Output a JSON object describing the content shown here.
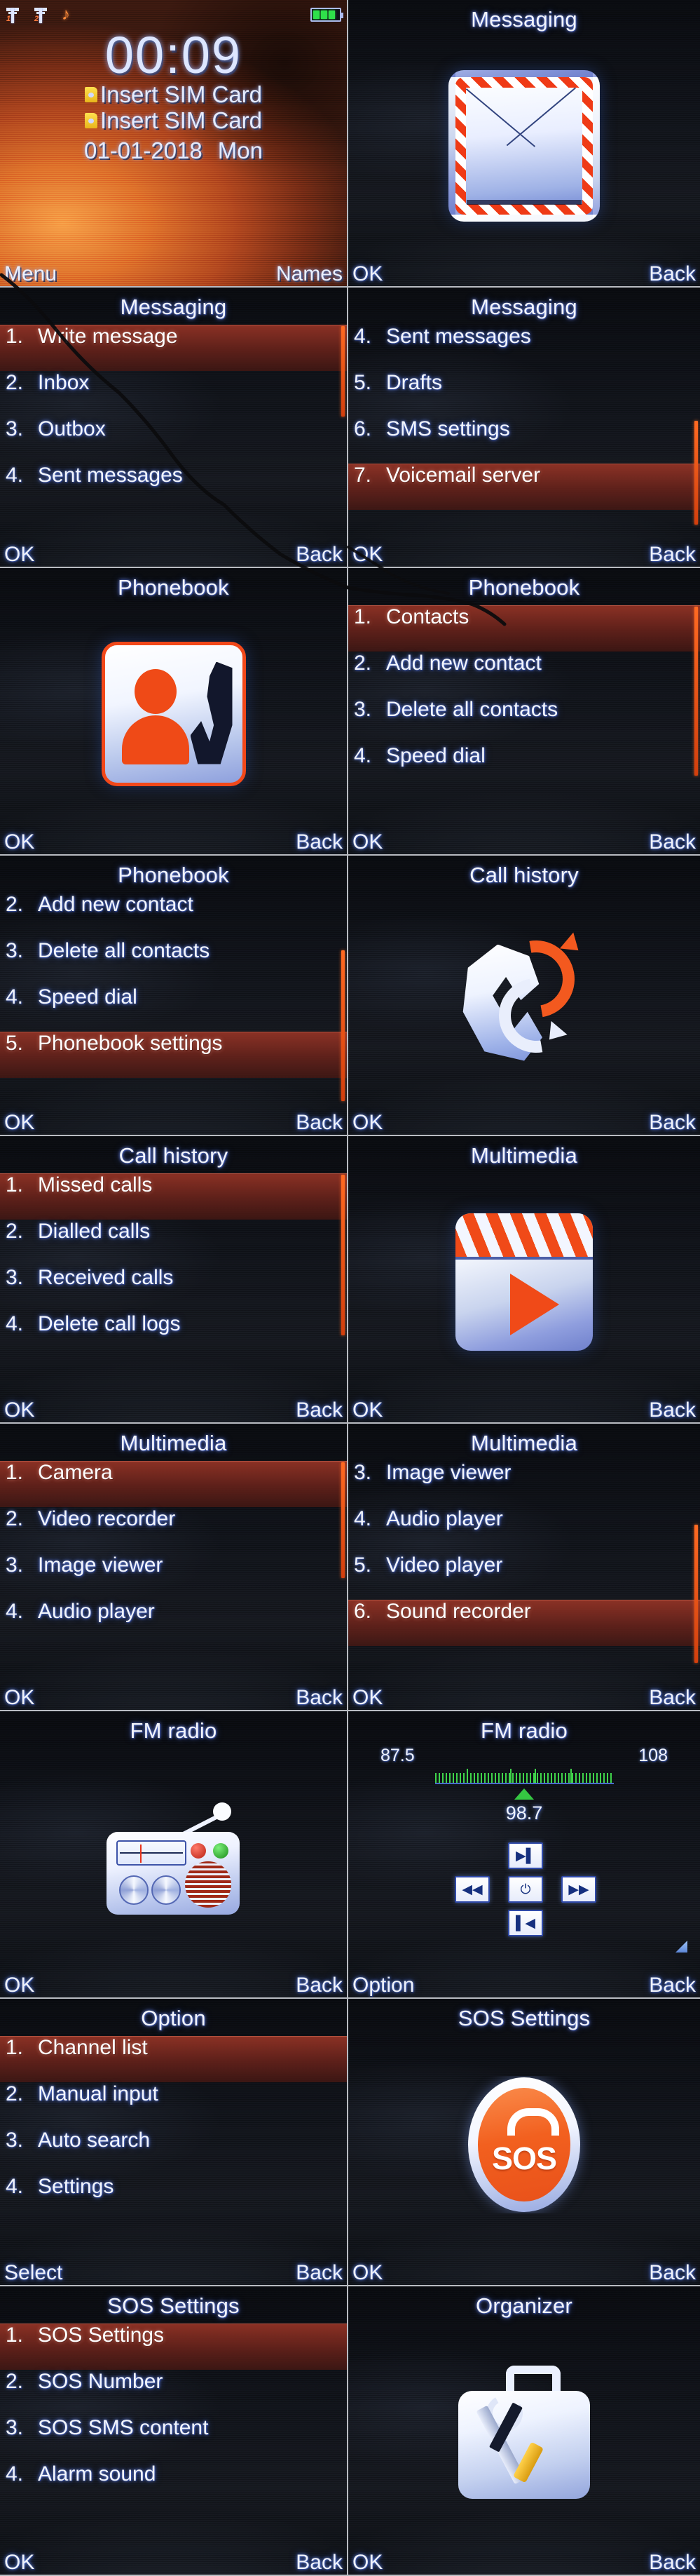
{
  "device": {
    "home": {
      "status": {
        "sim1_icon": "signal-sim1-icon",
        "sim2_icon": "signal-sim2-icon",
        "music_icon": "music-note-icon",
        "battery_icon": "battery-icon",
        "battery_bars": 3
      },
      "clock": "00:09",
      "sim1_text": "Insert SIM Card",
      "sim2_text": "Insert SIM Card",
      "date": "01-01-2018",
      "weekday": "Mon",
      "softkey_left": "Menu",
      "softkey_right": "Names"
    },
    "softkeys": {
      "ok": "OK",
      "back": "Back",
      "option": "Option",
      "select": "Select"
    },
    "screens": [
      {
        "id": "messaging-icon",
        "title": "Messaging",
        "kind": "icon",
        "icon": "envelope-icon",
        "left_key": "OK",
        "right_key": "Back"
      },
      {
        "id": "messaging-menu-1",
        "title": "Messaging",
        "kind": "list",
        "left_key": "OK",
        "right_key": "Back",
        "selected_index": 0,
        "scroll_top_pct": 2,
        "scroll_height_pct": 42,
        "items": [
          {
            "num": "1.",
            "label": "Write message"
          },
          {
            "num": "2.",
            "label": "Inbox"
          },
          {
            "num": "3.",
            "label": "Outbox"
          },
          {
            "num": "4.",
            "label": "Sent messages"
          }
        ]
      },
      {
        "id": "messaging-menu-2",
        "title": "Messaging",
        "kind": "list",
        "left_key": "OK",
        "right_key": "Back",
        "selected_index": 3,
        "scroll_top_pct": 46,
        "scroll_height_pct": 48,
        "items": [
          {
            "num": "4.",
            "label": "Sent messages"
          },
          {
            "num": "5.",
            "label": "Drafts"
          },
          {
            "num": "6.",
            "label": "SMS settings"
          },
          {
            "num": "7.",
            "label": "Voicemail server"
          }
        ]
      },
      {
        "id": "phonebook-icon",
        "title": "Phonebook",
        "kind": "icon",
        "icon": "phonebook-icon",
        "left_key": "OK",
        "right_key": "Back"
      },
      {
        "id": "phonebook-menu-1",
        "title": "Phonebook",
        "kind": "list",
        "left_key": "OK",
        "right_key": "Back",
        "selected_index": 0,
        "scroll_top_pct": 2,
        "scroll_height_pct": 76,
        "items": [
          {
            "num": "1.",
            "label": "Contacts"
          },
          {
            "num": "2.",
            "label": "Add new contact"
          },
          {
            "num": "3.",
            "label": "Delete all contacts"
          },
          {
            "num": "4.",
            "label": "Speed dial"
          }
        ]
      },
      {
        "id": "phonebook-menu-2",
        "title": "Phonebook",
        "kind": "list",
        "left_key": "OK",
        "right_key": "Back",
        "selected_index": 3,
        "scroll_top_pct": 28,
        "scroll_height_pct": 70,
        "items": [
          {
            "num": "2.",
            "label": "Add new contact"
          },
          {
            "num": "3.",
            "label": "Delete all contacts"
          },
          {
            "num": "4.",
            "label": "Speed dial"
          },
          {
            "num": "5.",
            "label": "Phonebook settings"
          }
        ]
      },
      {
        "id": "call-history-icon",
        "title": "Call history",
        "kind": "icon",
        "icon": "call-history-icon",
        "left_key": "OK",
        "right_key": "Back"
      },
      {
        "id": "call-history-menu",
        "title": "Call history",
        "kind": "list",
        "left_key": "OK",
        "right_key": "Back",
        "selected_index": 0,
        "scroll_top_pct": 2,
        "scroll_height_pct": 72,
        "items": [
          {
            "num": "1.",
            "label": "Missed calls"
          },
          {
            "num": "2.",
            "label": "Dialled calls"
          },
          {
            "num": "3.",
            "label": "Received calls"
          },
          {
            "num": "4.",
            "label": "Delete call logs"
          }
        ]
      },
      {
        "id": "multimedia-icon",
        "title": "Multimedia",
        "kind": "icon",
        "icon": "film-clapper-icon",
        "left_key": "OK",
        "right_key": "Back"
      },
      {
        "id": "multimedia-menu-1",
        "title": "Multimedia",
        "kind": "list",
        "left_key": "OK",
        "right_key": "Back",
        "selected_index": 0,
        "scroll_top_pct": 2,
        "scroll_height_pct": 52,
        "items": [
          {
            "num": "1.",
            "label": "Camera"
          },
          {
            "num": "2.",
            "label": "Video recorder"
          },
          {
            "num": "3.",
            "label": "Image viewer"
          },
          {
            "num": "4.",
            "label": "Audio player"
          }
        ]
      },
      {
        "id": "multimedia-menu-2",
        "title": "Multimedia",
        "kind": "list",
        "left_key": "OK",
        "right_key": "Back",
        "selected_index": 3,
        "scroll_top_pct": 30,
        "scroll_height_pct": 62,
        "items": [
          {
            "num": "3.",
            "label": "Image viewer"
          },
          {
            "num": "4.",
            "label": "Audio player"
          },
          {
            "num": "5.",
            "label": "Video player"
          },
          {
            "num": "6.",
            "label": "Sound recorder"
          }
        ]
      },
      {
        "id": "fm-radio-icon",
        "title": "FM radio",
        "kind": "icon",
        "icon": "radio-icon",
        "left_key": "OK",
        "right_key": "Back"
      },
      {
        "id": "fm-radio-player",
        "title": "FM radio",
        "kind": "fmplayer",
        "left_key": "Option",
        "right_key": "Back",
        "band_min": "87.5",
        "band_max": "108",
        "current_frequency": "98.7",
        "controls": {
          "next": "next-track-icon",
          "rewind": "rewind-icon",
          "power": "power-icon",
          "forward": "fast-forward-icon",
          "previous": "previous-track-icon",
          "volume": "volume-icon"
        }
      },
      {
        "id": "fm-option-menu",
        "title": "Option",
        "kind": "list",
        "left_key": "Select",
        "right_key": "Back",
        "selected_index": 0,
        "scroll_top_pct": 0,
        "scroll_height_pct": 0,
        "items": [
          {
            "num": "1.",
            "label": "Channel list"
          },
          {
            "num": "2.",
            "label": "Manual input"
          },
          {
            "num": "3.",
            "label": "Auto search"
          },
          {
            "num": "4.",
            "label": "Settings"
          }
        ]
      },
      {
        "id": "sos-settings-icon",
        "title": "SOS Settings",
        "kind": "icon",
        "icon": "sos-icon",
        "left_key": "OK",
        "right_key": "Back"
      },
      {
        "id": "sos-settings-menu",
        "title": "SOS Settings",
        "kind": "list",
        "left_key": "OK",
        "right_key": "Back",
        "selected_index": 0,
        "scroll_top_pct": 0,
        "scroll_height_pct": 0,
        "items": [
          {
            "num": "1.",
            "label": "SOS Settings"
          },
          {
            "num": "2.",
            "label": "SOS Number"
          },
          {
            "num": "3.",
            "label": "SOS SMS content"
          },
          {
            "num": "4.",
            "label": "Alarm sound"
          }
        ]
      },
      {
        "id": "organizer-icon",
        "title": "Organizer",
        "kind": "icon",
        "icon": "toolbox-icon",
        "left_key": "OK",
        "right_key": "Back"
      }
    ]
  }
}
